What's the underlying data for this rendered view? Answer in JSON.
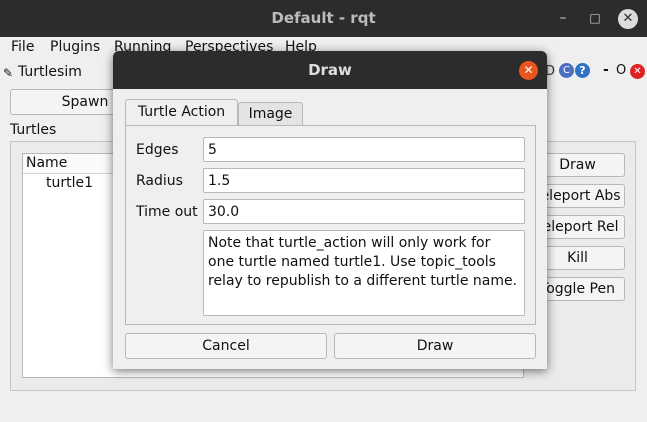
{
  "window": {
    "title": "Default - rqt",
    "minimize": "–",
    "maximize": "□",
    "close": "✕"
  },
  "menubar": [
    {
      "label": "File"
    },
    {
      "label": "Plugins"
    },
    {
      "label": "Running"
    },
    {
      "label": "Perspectives"
    },
    {
      "label": "Help"
    }
  ],
  "plugin": {
    "title": "Turtlesim",
    "controls": [
      "D",
      "C",
      "?",
      "-",
      "O"
    ],
    "close": "✕"
  },
  "sidebar": {
    "spawn_label": "Spawn",
    "turtles_label": "Turtles",
    "list_header": "Name",
    "turtles": [
      "turtle1"
    ]
  },
  "actions": [
    "Draw",
    "Teleport Abs",
    "Teleport Rel",
    "Kill",
    "Toggle Pen"
  ],
  "dialog": {
    "title": "Draw",
    "close": "✕",
    "tabs": [
      {
        "label": "Turtle Action",
        "active": true
      },
      {
        "label": "Image",
        "active": false
      }
    ],
    "fields": [
      {
        "label": "Edges",
        "value": "5"
      },
      {
        "label": "Radius",
        "value": "1.5"
      },
      {
        "label": "Time out",
        "value": "30.0"
      }
    ],
    "note": "Note that turtle_action will only work for one turtle named turtle1. Use topic_tools relay to republish to a different turtle name.",
    "cancel_label": "Cancel",
    "draw_label": "Draw"
  },
  "colors": {
    "titlebar": "#2c2c2c",
    "close_accent": "#e9541f",
    "window_bg": "#efefef"
  }
}
